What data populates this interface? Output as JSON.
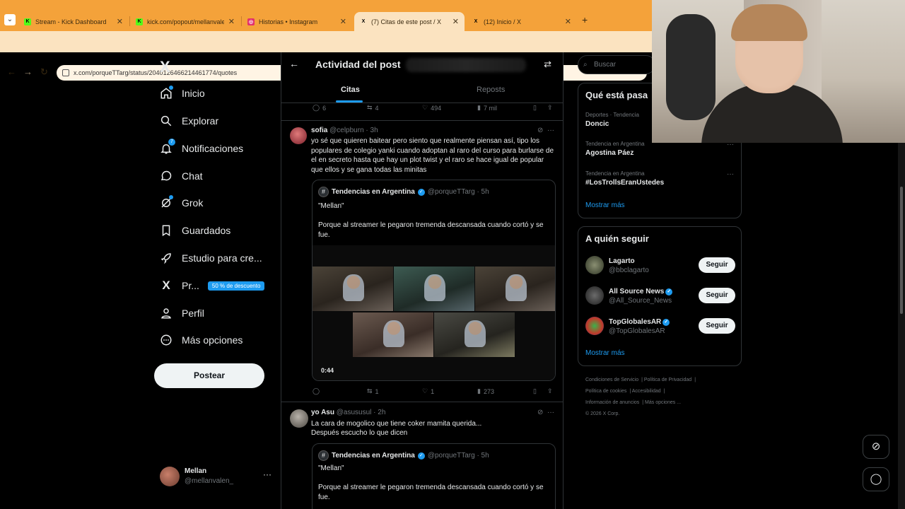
{
  "browser": {
    "tabs": [
      {
        "title": "Stream - Kick Dashboard",
        "favicon_color": "#53fc18",
        "favicon_text": "K"
      },
      {
        "title": "kick.com/popout/mellanvalen/c",
        "favicon_color": "#53fc18",
        "favicon_text": "K"
      },
      {
        "title": "Historias • Instagram",
        "favicon_color": "#e1306c",
        "favicon_text": "◎"
      },
      {
        "title": "(7) Citas de este post / X",
        "favicon_color": "#ffffff",
        "favicon_text": "X"
      },
      {
        "title": "(12) Inicio / X",
        "favicon_color": "#ffffff",
        "favicon_text": "X"
      }
    ],
    "url": "x.com/porqueTTarg/status/2040126466214461774/quotes",
    "accent": "#f4a23a"
  },
  "sidebar": {
    "logo": "X",
    "items": [
      {
        "label": "Inicio"
      },
      {
        "label": "Explorar"
      },
      {
        "label": "Notificaciones",
        "badge": "7"
      },
      {
        "label": "Chat"
      },
      {
        "label": "Grok"
      },
      {
        "label": "Guardados"
      },
      {
        "label": "Estudio para cre..."
      },
      {
        "label": "Pr...",
        "promo": "50 % de descuento"
      },
      {
        "label": "Perfil"
      },
      {
        "label": "Más opciones"
      }
    ],
    "post_button": "Postear",
    "profile": {
      "name": "Mellan",
      "handle": "@mellanvalen_"
    }
  },
  "main": {
    "title": "Actividad del post",
    "tabs": [
      "Citas",
      "Reposts"
    ],
    "top_actions": {
      "replies": "6",
      "reposts": "4",
      "likes": "494",
      "views": "7 mil"
    },
    "tweets": [
      {
        "name": "sofia",
        "handle": "@celpburn",
        "time": "· 3h",
        "text": "yo sé que quieren baitear pero siento que realmente piensan así, tipo los populares de colegio yanki cuando adoptan al raro del curso para burlarse de el en secreto hasta que hay un plot twist y el raro se hace igual de popular que ellos y se gana todas las minitas",
        "quote": {
          "name": "Tendencias en Argentina",
          "handle": "@porqueTTarg",
          "time": "· 5h",
          "line1": "\"Mellan\"",
          "line2": "Porque al streamer le pegaron tremenda descansada cuando cortó y se fue.",
          "video_time": "0:44"
        },
        "actions": {
          "replies": "",
          "reposts": "1",
          "likes": "1",
          "views": "273"
        }
      },
      {
        "name": "yo Asu",
        "handle": "@asususul",
        "time": "· 2h",
        "text_line1": "La cara de mogolico que tiene coker mamita querida...",
        "text_line2": "Después escucho lo que dicen",
        "quote": {
          "name": "Tendencias en Argentina",
          "handle": "@porqueTTarg",
          "time": "· 5h",
          "line1": "\"Mellan\"",
          "line2": "Porque al streamer le pegaron tremenda descansada cuando cortó y se fue."
        }
      }
    ]
  },
  "right": {
    "search_placeholder": "Buscar",
    "trends_title": "Qué está pasa",
    "trends": [
      {
        "context": "Deportes · Tendencia",
        "name": "Doncic"
      },
      {
        "context": "Tendencia en Argentina",
        "name": "Agostina Páez"
      },
      {
        "context": "Tendencia en Argentina",
        "name": "#LosTrollsEranUstedes"
      }
    ],
    "show_more": "Mostrar más",
    "follow_title": "A quién seguir",
    "follow": [
      {
        "name": "Lagarto",
        "handle": "@bbclagarto",
        "verified": false,
        "button": "Seguir"
      },
      {
        "name": "All Source News",
        "handle": "@All_Source_News",
        "verified": true,
        "button": "Seguir"
      },
      {
        "name": "TopGlobalesAR",
        "handle": "@TopGlobalesAR",
        "verified": true,
        "button": "Seguir"
      }
    ],
    "footer": {
      "links": [
        "Condiciones de Servicio",
        "Política de Privacidad",
        "Política de cookies",
        "Accesibilidad",
        "Información de anuncios",
        "Más opciones ..."
      ],
      "copyright": "© 2026 X Corp."
    }
  }
}
